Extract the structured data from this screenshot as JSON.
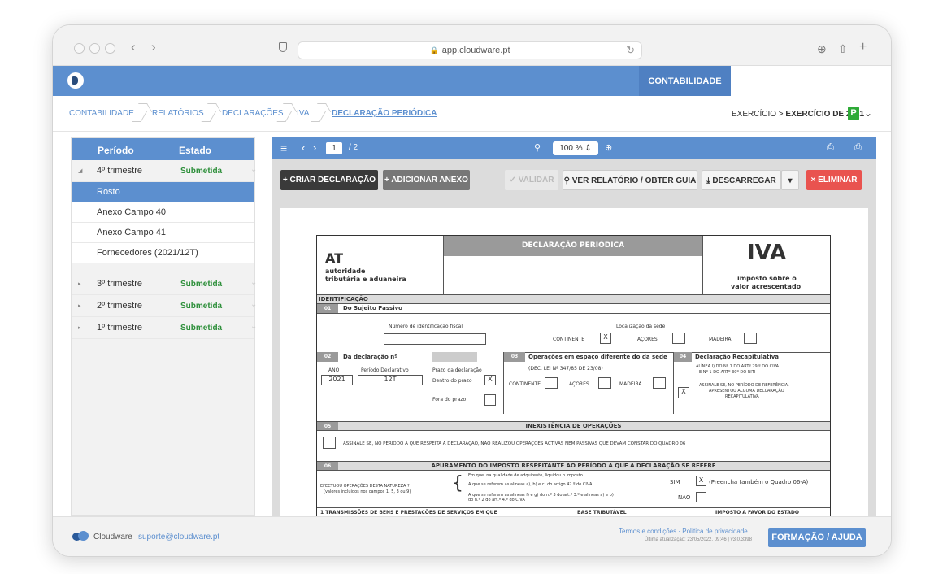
{
  "browser": {
    "url": "app.cloudware.pt"
  },
  "app": {
    "active_tab": "CONTABILIDADE"
  },
  "breadcrumbs": [
    "CONTABILIDADE",
    "RELATÓRIOS",
    "DECLARAÇÕES",
    "IVA",
    "DECLARAÇÃO PERIÓDICA"
  ],
  "exercise": {
    "prefix": "EXERCÍCIO > ",
    "value": "EXERCÍCIO DE 2021",
    "badge": "P"
  },
  "sidebar": {
    "col_period": "Período",
    "col_state": "Estado",
    "q4": {
      "label": "4º trimestre",
      "state": "Submetida"
    },
    "q4_items": [
      "Rosto",
      "Anexo Campo 40",
      "Anexo Campo 41",
      "Fornecedores (2021/12T)"
    ],
    "q3": {
      "label": "3º trimestre",
      "state": "Submetida"
    },
    "q2": {
      "label": "2º trimestre",
      "state": "Submetida"
    },
    "q1": {
      "label": "1º trimestre",
      "state": "Submetida"
    }
  },
  "pdf": {
    "page": "1",
    "pages": "/ 2",
    "zoom": "100 %"
  },
  "toolbar": {
    "create": "+ CRIAR DECLARAÇÃO",
    "attach": "+ ADICIONAR ANEXO",
    "validate": "✓ VALIDAR",
    "report": "VER RELATÓRIO / OBTER GUIA",
    "download": "DESCARREGAR",
    "delete": "× ELIMINAR"
  },
  "form": {
    "at": "AT",
    "at_sub1": "autoridade",
    "at_sub2": "tributária e aduaneira",
    "title": "DECLARAÇÃO PERIÓDICA",
    "iva": "IVA",
    "iva_sub1": "imposto sobre o",
    "iva_sub2": "valor acrescentado",
    "ident": "IDENTIFICAÇÃO",
    "s01_num": "01",
    "s01": "Do Sujeito Passivo",
    "nif_label": "Número de identificação fiscal",
    "sede_label": "Localização da sede",
    "continente": "CONTINENTE",
    "continente_mark": "X",
    "acores": "AÇORES",
    "madeira": "MADEIRA",
    "s02_num": "02",
    "s02": "Da declaração  nº",
    "ano_label": "ANO",
    "periodo_label": "Período Declarativo",
    "prazo_label": "Prazo da declaração",
    "ano": "2021",
    "periodo": "12T",
    "dentro": "Dentro do prazo",
    "dentro_mark": "X",
    "fora": "Fora do prazo",
    "s03_num": "03",
    "s03": "Operações em espaço diferente do da sede",
    "s03_note": "(DEC. LEI Nº 347/85 DE 23/08)",
    "s03_cont": "CONTINENTE",
    "s03_acores": "AÇORES",
    "s03_madeira": "MADEIRA",
    "s04_num": "04",
    "s04": "Declaração Recapitulativa",
    "s04_note1": "ALÍNEA I) DO Nº 1 DO ARTº 29.º DO CIVA",
    "s04_note2": "E Nº 1 DO ARTº 30º DO RITI",
    "s04_mark": "X",
    "s04_text1": "ASSINALE SE, NO PERÍODO DE REFERÊNCIA,",
    "s04_text2": "APRESENTOU ALGUMA DECLARAÇÃO",
    "s04_text3": "RECAPITULATIVA",
    "s05_num": "05",
    "s05": "INEXISTÊNCIA DE OPERAÇÕES",
    "s05_text": "ASSINALE SE, NO PERÍODO A QUE RESPEITA A DECLARAÇÃO, NÃO REALIZOU OPERAÇÕES ACTIVAS NEM PASSIVAS QUE DEVAM CONSTAR DO QUADRO 06",
    "s06_num": "06",
    "s06": "APURAMENTO DO IMPOSTO RESPEITANTE AO PERÍODO A QUE A DECLARAÇÃO SE REFERE",
    "s06_q1": "EFECTUOU OPERAÇÕES DESTA NATUREZA ?",
    "s06_q2": "(valores incluídos nos campos 1, 5, 3 ou 9)",
    "s06_head": "Em que, na qualidade de adquirente, liquidou o imposto",
    "s06_a": "A que se referem as alíneas a), b) e c) do artigo 42.º do CIVA",
    "s06_b": "A que se referem as alíneas f) e g) do n.º 3 do art.º 3.º e alíneas a) e b)",
    "s06_b2": "do n.º 2 do art.º 4.º do CIVA",
    "sim": "SIM",
    "sim_mark": "X",
    "sim_note": "(Preencha também o Quadro 06-A)",
    "nao": "NÃO",
    "row1": "1  TRANSMISSÕES DE BENS E PRESTAÇÕES DE SERVIÇOS EM QUE",
    "base": "BASE TRIBUTÁVEL",
    "imposto": "IMPOSTO A FAVOR DO ESTADO"
  },
  "footer": {
    "brand": "Cloudware",
    "email": "suporte@cloudware.pt",
    "links": "Termos e condições · Política de privacidade",
    "updated": "Última atualização: 23/05/2022, 09:46 | v3.0.3398",
    "help": "FORMAÇÃO / AJUDA"
  }
}
